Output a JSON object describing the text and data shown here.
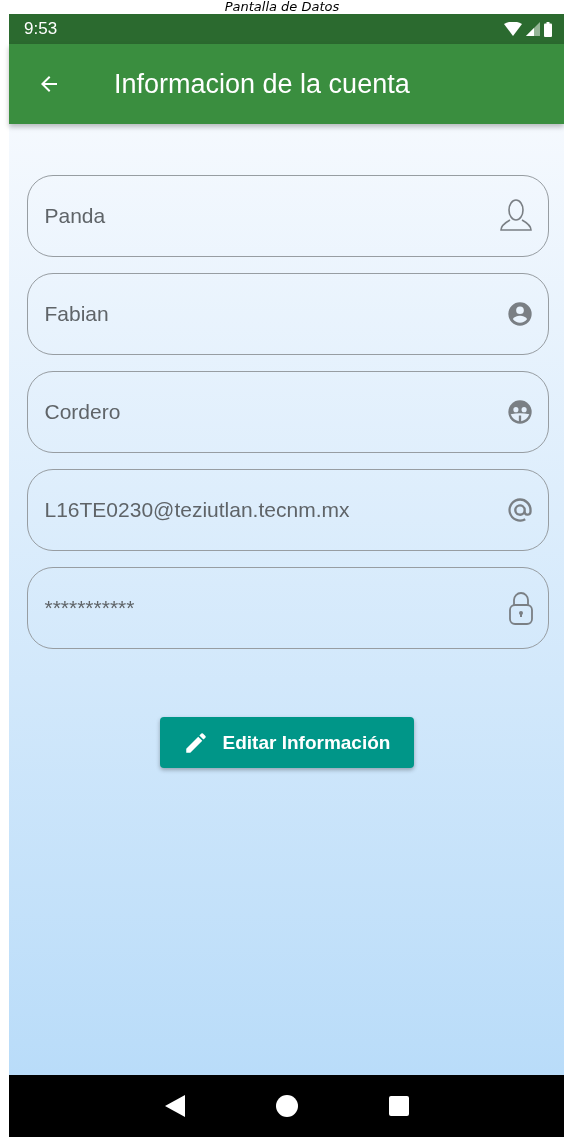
{
  "caption": "Pantalla de Datos",
  "status_bar": {
    "time": "9:53"
  },
  "app_bar": {
    "title": "Informacion de la cuenta"
  },
  "fields": [
    {
      "value": "Panda",
      "kind": "username"
    },
    {
      "value": "Fabian",
      "kind": "firstname"
    },
    {
      "value": "Cordero",
      "kind": "lastname"
    },
    {
      "value": "L16TE0230@teziutlan.tecnm.mx",
      "kind": "email"
    },
    {
      "value": "***********",
      "kind": "password"
    }
  ],
  "button": {
    "label": "Editar Información"
  }
}
